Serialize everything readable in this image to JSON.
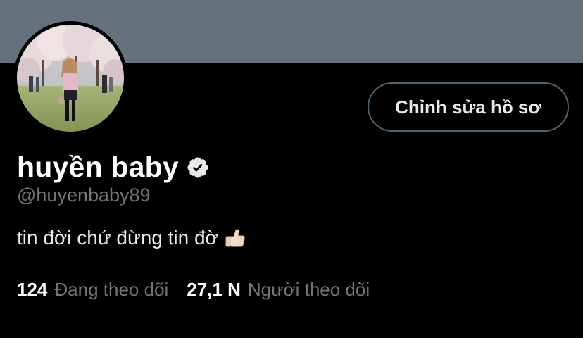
{
  "profile": {
    "display_name": "huyền baby",
    "handle": "@huyenbaby89",
    "bio": "tin đời chứ đừng tin đờ",
    "bio_emoji_icon": "thumbs-up-icon",
    "verified_icon": "verified-badge-icon",
    "edit_button_label": "Chỉnh sửa hồ sơ"
  },
  "stats": {
    "following_count": "124",
    "following_label": "Đang theo dõi",
    "followers_count": "27,1 N",
    "followers_label": "Người theo dõi"
  },
  "colors": {
    "banner": "#66717d",
    "background": "#000000",
    "secondary_text": "#71767b",
    "primary_text": "#e7e9ea",
    "button_border": "#536471"
  }
}
